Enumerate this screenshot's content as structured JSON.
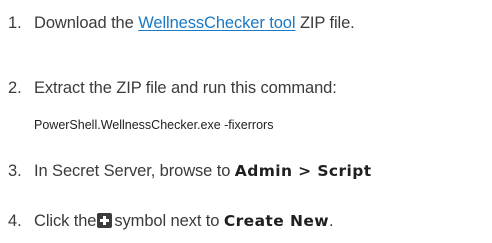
{
  "steps": [
    {
      "number": "1.",
      "before": "Download the",
      "link": "WellnessChecker tool",
      "after": "ZIP file."
    },
    {
      "number": "2.",
      "text": "Extract the ZIP file and run this command:",
      "command": "PowerShell.WellnessChecker.exe -fixerrors"
    },
    {
      "number": "3.",
      "before": "In Secret Server, browse to",
      "bold": "Admin > Script"
    },
    {
      "number": "4.",
      "before": "Click the",
      "icon": "plus-square-icon",
      "middle": "symbol next to",
      "bold": "Create New",
      "after": "."
    }
  ]
}
